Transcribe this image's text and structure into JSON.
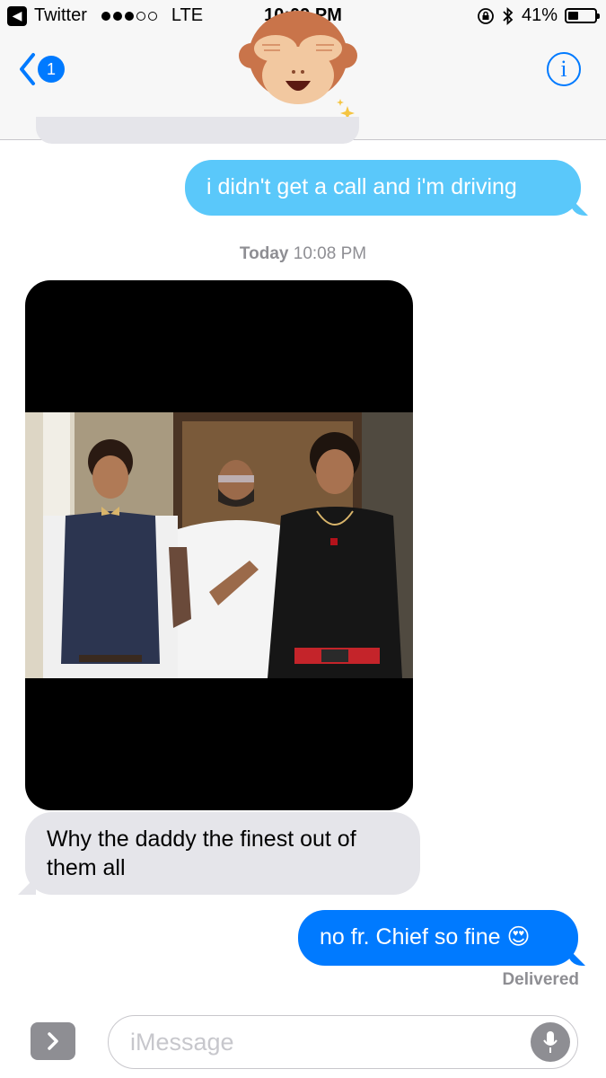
{
  "status_bar": {
    "back_app": "Twitter",
    "carrier": "LTE",
    "time": "10:09 PM",
    "battery": "41%",
    "battery_level": 0.41,
    "signal_bars": 3
  },
  "nav": {
    "unread_count": "1",
    "info_label": "i"
  },
  "messages": [
    {
      "id": "m1",
      "direction": "outgoing",
      "kind": "sms",
      "text": "i didn't get a call and i'm driving"
    },
    {
      "id": "m2",
      "direction": "incoming",
      "kind": "photo"
    },
    {
      "id": "m3",
      "direction": "incoming",
      "text": "Why the daddy the finest out of them all"
    },
    {
      "id": "m4",
      "direction": "outgoing",
      "kind": "imessage",
      "text": "no fr. Chief so fine 😍"
    }
  ],
  "timestamp": {
    "day": "Today",
    "time": "10:08 PM"
  },
  "delivered": "Delivered",
  "composer": {
    "placeholder": "iMessage"
  },
  "colors": {
    "sms_bubble": "#5ac8fa",
    "imessage_bubble": "#007aff",
    "incoming_bubble": "#e5e5ea",
    "accent": "#007aff"
  }
}
